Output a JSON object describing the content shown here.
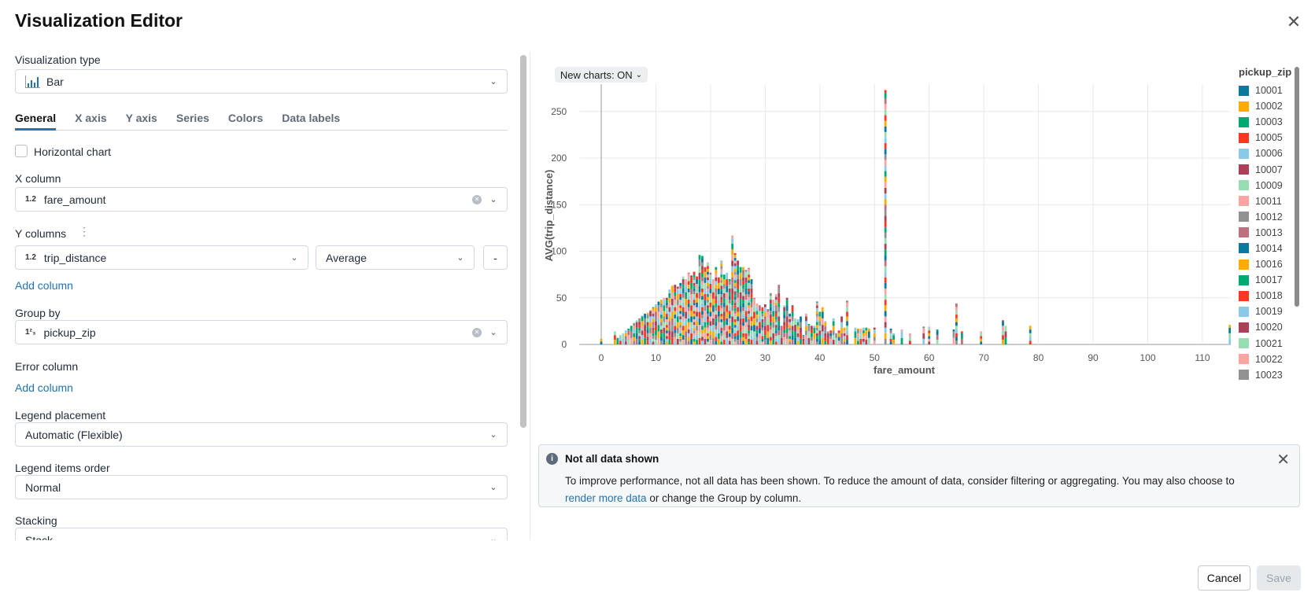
{
  "header": {
    "title": "Visualization Editor",
    "close_icon": "close-icon"
  },
  "editor": {
    "viz_type_label": "Visualization type",
    "viz_type_value": "Bar",
    "tabs": [
      {
        "label": "General"
      },
      {
        "label": "X axis"
      },
      {
        "label": "Y axis"
      },
      {
        "label": "Series"
      },
      {
        "label": "Colors"
      },
      {
        "label": "Data labels"
      }
    ],
    "active_tab": "General",
    "horizontal_chart_label": "Horizontal chart",
    "horizontal_chart_checked": false,
    "x_column_label": "X column",
    "x_column_type": "1.2",
    "x_column_value": "fare_amount",
    "y_columns_label": "Y columns",
    "y_column_type": "1.2",
    "y_column_value": "trip_distance",
    "y_aggregation": "Average",
    "remove_label": "-",
    "add_column_label": "Add column",
    "group_by_label": "Group by",
    "group_by_type": "1²₃",
    "group_by_value": "pickup_zip",
    "error_column_label": "Error column",
    "error_add_column_label": "Add column",
    "legend_placement_label": "Legend placement",
    "legend_placement_value": "Automatic (Flexible)",
    "legend_order_label": "Legend items order",
    "legend_order_value": "Normal",
    "stacking_label": "Stacking",
    "stacking_value": "Stack"
  },
  "preview": {
    "new_charts_label": "New charts: ON",
    "alert": {
      "title": "Not all data shown",
      "body_pre": "To improve performance, not all data has been shown. To reduce the amount of data, consider filtering or aggregating. You may also choose to ",
      "link": "render more data",
      "body_post": " or change the Group by column."
    }
  },
  "footer": {
    "cancel_label": "Cancel",
    "save_label": "Save"
  },
  "chart_data": {
    "type": "bar",
    "stacked": true,
    "xlabel": "fare_amount",
    "ylabel": "AVG(trip_distance)",
    "xlim": [
      -4,
      116
    ],
    "ylim": [
      0,
      280
    ],
    "xticks": [
      0,
      10,
      20,
      30,
      40,
      50,
      60,
      70,
      80,
      90,
      100,
      110
    ],
    "yticks": [
      0,
      50,
      100,
      150,
      200,
      250
    ],
    "grid": true,
    "legend_title": "pickup_zip",
    "legend_placement": "right",
    "series": [
      {
        "name": "10001",
        "color": "#077A9D"
      },
      {
        "name": "10002",
        "color": "#FFAB00"
      },
      {
        "name": "10003",
        "color": "#00A972"
      },
      {
        "name": "10005",
        "color": "#FF3621"
      },
      {
        "name": "10006",
        "color": "#8BCAE7"
      },
      {
        "name": "10007",
        "color": "#AB4057"
      },
      {
        "name": "10009",
        "color": "#99DDB4"
      },
      {
        "name": "10011",
        "color": "#FCA4A1"
      },
      {
        "name": "10012",
        "color": "#919191"
      },
      {
        "name": "10013",
        "color": "#BF7080"
      },
      {
        "name": "10014",
        "color": "#077A9D"
      },
      {
        "name": "10016",
        "color": "#FFAB00"
      },
      {
        "name": "10017",
        "color": "#00A972"
      },
      {
        "name": "10018",
        "color": "#FF3621"
      },
      {
        "name": "10019",
        "color": "#8BCAE7"
      },
      {
        "name": "10020",
        "color": "#AB4057"
      },
      {
        "name": "10021",
        "color": "#99DDB4"
      },
      {
        "name": "10022",
        "color": "#FCA4A1"
      },
      {
        "name": "10023",
        "color": "#919191"
      }
    ],
    "bar_totals": [
      [
        0,
        6
      ],
      [
        2.5,
        14
      ],
      [
        3,
        7
      ],
      [
        3.5,
        10
      ],
      [
        4,
        12
      ],
      [
        4.5,
        15
      ],
      [
        5,
        17
      ],
      [
        5.5,
        20
      ],
      [
        6,
        23
      ],
      [
        6.5,
        26
      ],
      [
        7,
        28
      ],
      [
        7.5,
        31
      ],
      [
        8,
        33
      ],
      [
        8.5,
        34
      ],
      [
        9,
        37
      ],
      [
        9.5,
        40
      ],
      [
        10,
        43
      ],
      [
        10.5,
        46
      ],
      [
        11,
        48
      ],
      [
        11.5,
        50
      ],
      [
        12,
        50
      ],
      [
        12.5,
        59
      ],
      [
        13,
        63
      ],
      [
        13.5,
        64
      ],
      [
        14,
        62
      ],
      [
        14.5,
        66
      ],
      [
        15,
        73
      ],
      [
        15.5,
        70
      ],
      [
        16,
        77
      ],
      [
        16.5,
        74
      ],
      [
        17,
        78
      ],
      [
        17.5,
        73
      ],
      [
        18,
        96
      ],
      [
        18.5,
        95
      ],
      [
        19,
        83
      ],
      [
        19.5,
        88
      ],
      [
        20,
        77
      ],
      [
        20.5,
        70
      ],
      [
        21,
        83
      ],
      [
        21.5,
        72
      ],
      [
        22,
        90
      ],
      [
        22.5,
        75
      ],
      [
        23,
        77
      ],
      [
        23.5,
        70
      ],
      [
        24,
        117
      ],
      [
        24.5,
        98
      ],
      [
        25,
        90
      ],
      [
        25.5,
        83
      ],
      [
        26,
        83
      ],
      [
        26.5,
        80
      ],
      [
        27,
        82
      ],
      [
        27.5,
        70
      ],
      [
        28,
        50
      ],
      [
        28.5,
        44
      ],
      [
        29,
        42
      ],
      [
        29.5,
        40
      ],
      [
        30,
        43
      ],
      [
        30.5,
        38
      ],
      [
        31,
        55
      ],
      [
        31.5,
        48
      ],
      [
        32,
        54
      ],
      [
        32.5,
        64
      ],
      [
        33,
        20
      ],
      [
        33.5,
        42
      ],
      [
        34,
        50
      ],
      [
        34.5,
        33
      ],
      [
        35,
        42
      ],
      [
        35.5,
        28
      ],
      [
        36,
        27
      ],
      [
        36.5,
        30
      ],
      [
        37,
        10
      ],
      [
        37.5,
        33
      ],
      [
        38,
        22
      ],
      [
        38.5,
        20
      ],
      [
        39,
        20
      ],
      [
        39.5,
        46
      ],
      [
        40,
        35
      ],
      [
        40.5,
        40
      ],
      [
        41,
        25
      ],
      [
        41.5,
        14
      ],
      [
        42,
        15
      ],
      [
        42.5,
        28
      ],
      [
        43,
        12
      ],
      [
        43.5,
        15
      ],
      [
        44,
        30
      ],
      [
        44.5,
        18
      ],
      [
        45,
        47
      ],
      [
        46.5,
        18
      ],
      [
        47,
        17
      ],
      [
        47.5,
        17
      ],
      [
        48,
        18
      ],
      [
        48.5,
        18
      ],
      [
        49,
        17
      ],
      [
        50,
        18
      ],
      [
        52,
        273
      ],
      [
        53,
        17
      ],
      [
        53.5,
        12
      ],
      [
        55,
        16
      ],
      [
        56.5,
        12
      ],
      [
        59,
        19
      ],
      [
        60,
        19
      ],
      [
        61.5,
        16
      ],
      [
        64.5,
        16
      ],
      [
        65,
        44
      ],
      [
        66,
        14
      ],
      [
        69.5,
        14
      ],
      [
        73.5,
        26
      ],
      [
        74,
        20
      ],
      [
        78.5,
        20
      ],
      [
        115,
        21
      ]
    ]
  }
}
